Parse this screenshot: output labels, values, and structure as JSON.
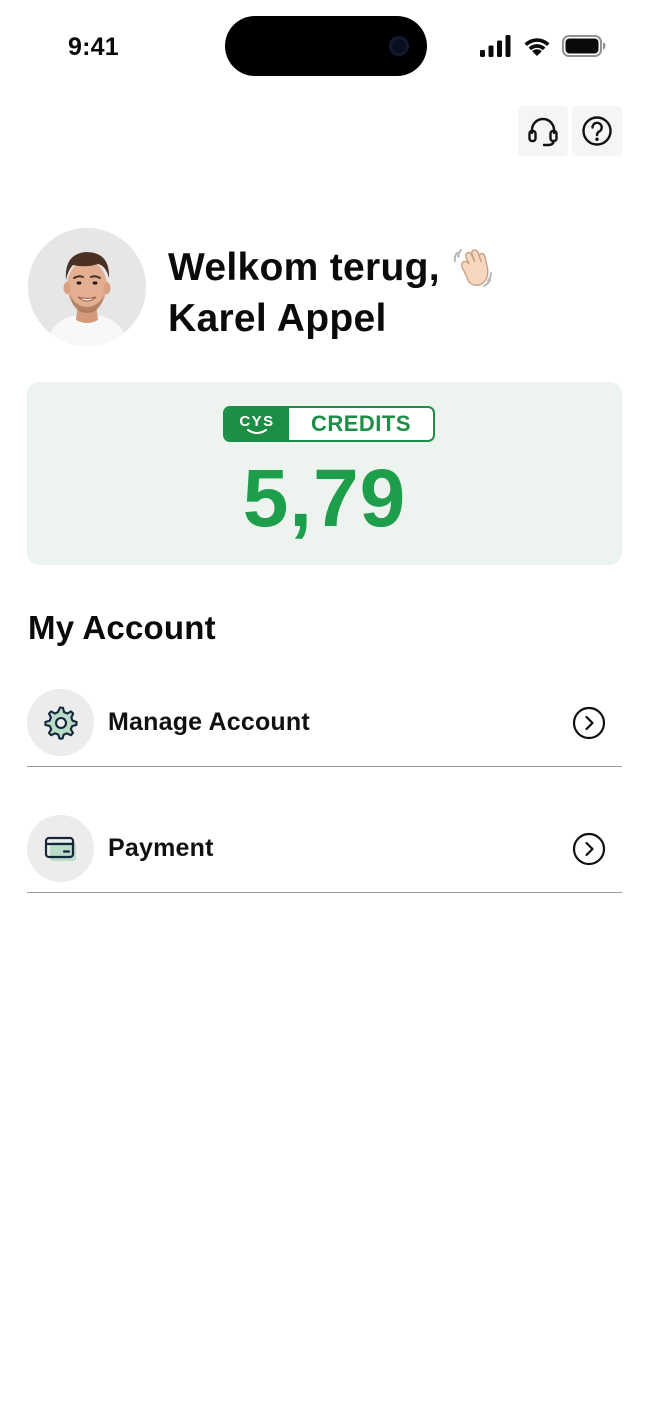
{
  "status_bar": {
    "time": "9:41",
    "icons": [
      "signal-icon",
      "wifi-icon",
      "battery-icon"
    ]
  },
  "top_actions": {
    "icons": [
      "headset-icon",
      "help-icon"
    ]
  },
  "welcome": {
    "line1": "Welkom terug,",
    "line2": "Karel Appel",
    "emoji": "waving-hand-icon"
  },
  "credits": {
    "logo_text": "CYS",
    "label": "CREDITS",
    "value": "5,79",
    "accent_color": "#1c9e4a",
    "card_bg": "#edf3ef"
  },
  "account": {
    "title": "My Account",
    "items": [
      {
        "label": "Manage Account",
        "icon": "gear-icon"
      },
      {
        "label": "Payment",
        "icon": "credit-card-icon"
      }
    ]
  }
}
